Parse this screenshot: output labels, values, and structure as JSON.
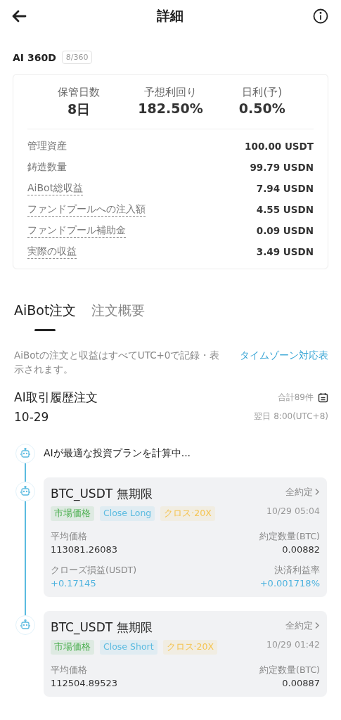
{
  "header": {
    "title": "詳細"
  },
  "plan": {
    "name": "AI 360D",
    "progress": "8/360"
  },
  "summary": {
    "stats": [
      {
        "label": "保管日数",
        "value": "8日"
      },
      {
        "label": "予想利回り",
        "value": "182.50%"
      },
      {
        "label": "日利(予)",
        "value": "0.50%"
      }
    ],
    "rows": [
      {
        "label": "管理資産",
        "value": "100.00 USDT",
        "dashed": false
      },
      {
        "label": "鋳造数量",
        "value": "99.79 USDN",
        "dashed": false
      },
      {
        "label": "AiBot総収益",
        "value": "7.94 USDN",
        "dashed": true
      },
      {
        "label": "ファンドプールへの注入額",
        "value": "4.55 USDN",
        "dashed": true
      },
      {
        "label": "ファンドプール補助金",
        "value": "0.09 USDN",
        "dashed": true
      },
      {
        "label": "実際の収益",
        "value": "3.49 USDN",
        "dashed": true
      }
    ]
  },
  "tabs": [
    {
      "label": "AiBot注文",
      "selected": true
    },
    {
      "label": "注文概要",
      "selected": false
    }
  ],
  "notice": {
    "text": "AiBotの注文と収益はすべてUTC+0で記録・表示されます。",
    "link": "タイムゾーン対応表"
  },
  "history": {
    "title": "AI取引履歴注文",
    "total": "合計89件",
    "date": "10-29",
    "settle": "翌日 8:00(UTC+8)"
  },
  "timeline": [
    {
      "kind": "status",
      "text": "AIが最適な投資プランを計算中..."
    },
    {
      "kind": "order",
      "pair": "BTC_USDT 無期限",
      "action": "全約定",
      "time": "10/29 05:04",
      "tags": [
        {
          "text": "市場価格",
          "color": "#4caf50"
        },
        {
          "text": "Close Long",
          "color": "#5bbbe0"
        },
        {
          "text": "クロス·20X",
          "color": "#f5c451"
        }
      ],
      "fields": [
        [
          {
            "label": "平均価格",
            "value": "113081.26083",
            "accent": false
          },
          {
            "label": "約定数量(BTC)",
            "value": "0.00882",
            "accent": false
          }
        ],
        [
          {
            "label": "クローズ損益(USDT)",
            "value": "+0.17145",
            "accent": true
          },
          {
            "label": "決済利益率",
            "value": "+0.001718%",
            "accent": true
          }
        ]
      ]
    },
    {
      "kind": "order",
      "pair": "BTC_USDT 無期限",
      "action": "全約定",
      "time": "10/29 01:42",
      "tags": [
        {
          "text": "市場価格",
          "color": "#4caf50"
        },
        {
          "text": "Close Short",
          "color": "#5bbbe0"
        },
        {
          "text": "クロス·20X",
          "color": "#f5c451"
        }
      ],
      "fields": [
        [
          {
            "label": "平均価格",
            "value": "112504.89523",
            "accent": false
          },
          {
            "label": "約定数量(BTC)",
            "value": "0.00887",
            "accent": false
          }
        ]
      ]
    }
  ]
}
